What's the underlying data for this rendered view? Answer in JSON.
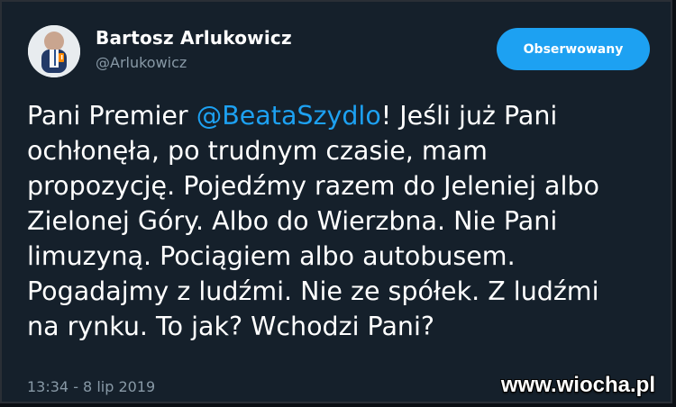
{
  "author": {
    "display_name": "Bartosz Arlukowicz",
    "handle": "@Arlukowicz"
  },
  "follow_button": {
    "label": "Obserwowany"
  },
  "tweet": {
    "line1_prefix": "Pani Premier ",
    "mention": "@BeataSzydlo",
    "line1_suffix": "! Jeśli już Pani\nochłonęła, po trudnym czasie, mam\npropozycję. Pojedźmy razem do Jeleniej albo\nZielonej Góry. Albo do Wierzbna. Nie Pani\nlimuzyną. Pociągiem albo autobusem.\nPogadajmy z ludźmi. Nie ze spółek. Z ludźmi\nna rynku. To jak? Wchodzi Pani?"
  },
  "timestamp": "13:34 - 8 lip 2019",
  "watermark": "www.wiocha.pl",
  "colors": {
    "background": "#15202b",
    "accent": "#1da1f2",
    "muted": "#8899a6",
    "text": "#ffffff"
  }
}
